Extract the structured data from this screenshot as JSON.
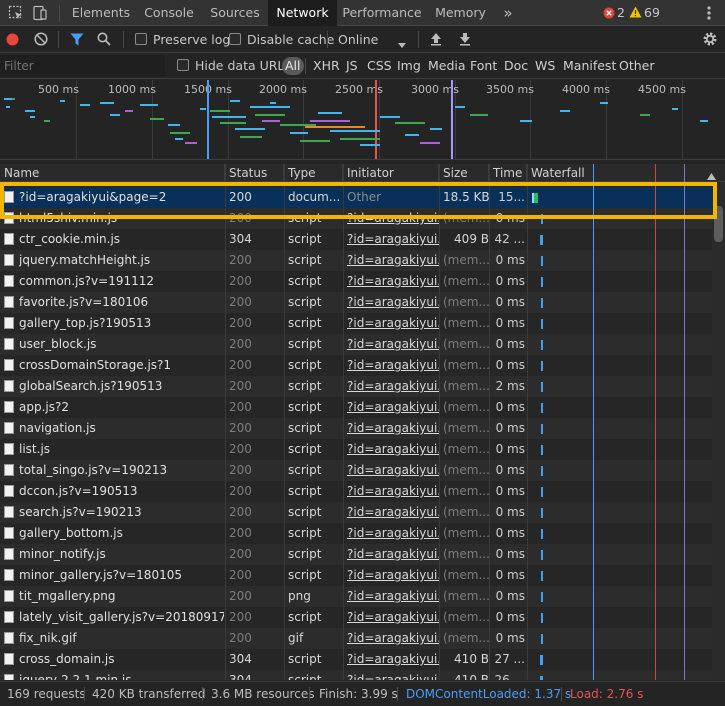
{
  "tabs": {
    "elements": "Elements",
    "console": "Console",
    "sources": "Sources",
    "network": "Network",
    "performance": "Performance",
    "memory": "Memory",
    "more": "»"
  },
  "badges": {
    "errors": "2",
    "warnings": "69"
  },
  "toolbar": {
    "preserve_log": "Preserve log",
    "disable_cache": "Disable cache",
    "throttling": "Online"
  },
  "filter": {
    "placeholder": "Filter",
    "hide_data_urls": "Hide data URLs",
    "types": [
      "All",
      "XHR",
      "JS",
      "CSS",
      "Img",
      "Media",
      "Font",
      "Doc",
      "WS",
      "Manifest",
      "Other"
    ]
  },
  "overview_ticks": [
    "500 ms",
    "1000 ms",
    "1500 ms",
    "2000 ms",
    "2500 ms",
    "3000 ms",
    "3500 ms",
    "4000 ms",
    "4500 ms"
  ],
  "columns": {
    "name": "Name",
    "status": "Status",
    "type": "Type",
    "initiator": "Initiator",
    "size": "Size",
    "time": "Time",
    "waterfall": "Waterfall"
  },
  "rows": [
    {
      "name": "?id=aragakiyui&page=2",
      "status": "200",
      "type": "docum...",
      "initiator": "Other",
      "size": "18.5 KB",
      "time": "15...",
      "selected": true
    },
    {
      "name": "html5shiv.min.js",
      "status": "200",
      "type": "script",
      "initiator": "?id=aragakiyui...",
      "size": "(mem...",
      "time": "0 ms"
    },
    {
      "name": "ctr_cookie.min.js",
      "status": "304",
      "type": "script",
      "initiator": "?id=aragakiyui...",
      "size": "409 B",
      "time": "42 ..."
    },
    {
      "name": "jquery.matchHeight.js",
      "status": "200",
      "type": "script",
      "initiator": "?id=aragakiyui...",
      "size": "(mem...",
      "time": "0 ms"
    },
    {
      "name": "common.js?v=191112",
      "status": "200",
      "type": "script",
      "initiator": "?id=aragakiyui...",
      "size": "(mem...",
      "time": "0 ms"
    },
    {
      "name": "favorite.js?v=180106",
      "status": "200",
      "type": "script",
      "initiator": "?id=aragakiyui...",
      "size": "(mem...",
      "time": "0 ms"
    },
    {
      "name": "gallery_top.js?190513",
      "status": "200",
      "type": "script",
      "initiator": "?id=aragakiyui...",
      "size": "(mem...",
      "time": "0 ms"
    },
    {
      "name": "user_block.js",
      "status": "200",
      "type": "script",
      "initiator": "?id=aragakiyui...",
      "size": "(mem...",
      "time": "0 ms"
    },
    {
      "name": "crossDomainStorage.js?1",
      "status": "200",
      "type": "script",
      "initiator": "?id=aragakiyui...",
      "size": "(mem...",
      "time": "0 ms"
    },
    {
      "name": "globalSearch.js?190513",
      "status": "200",
      "type": "script",
      "initiator": "?id=aragakiyui...",
      "size": "(mem...",
      "time": "2 ms"
    },
    {
      "name": "app.js?2",
      "status": "200",
      "type": "script",
      "initiator": "?id=aragakiyui...",
      "size": "(mem...",
      "time": "0 ms"
    },
    {
      "name": "navigation.js",
      "status": "200",
      "type": "script",
      "initiator": "?id=aragakiyui...",
      "size": "(mem...",
      "time": "0 ms"
    },
    {
      "name": "list.js",
      "status": "200",
      "type": "script",
      "initiator": "?id=aragakiyui...",
      "size": "(mem...",
      "time": "0 ms"
    },
    {
      "name": "total_singo.js?v=190213",
      "status": "200",
      "type": "script",
      "initiator": "?id=aragakiyui...",
      "size": "(mem...",
      "time": "0 ms"
    },
    {
      "name": "dccon.js?v=190513",
      "status": "200",
      "type": "script",
      "initiator": "?id=aragakiyui...",
      "size": "(mem...",
      "time": "0 ms"
    },
    {
      "name": "search.js?v=190213",
      "status": "200",
      "type": "script",
      "initiator": "?id=aragakiyui...",
      "size": "(mem...",
      "time": "0 ms"
    },
    {
      "name": "gallery_bottom.js",
      "status": "200",
      "type": "script",
      "initiator": "?id=aragakiyui...",
      "size": "(mem...",
      "time": "0 ms"
    },
    {
      "name": "minor_notify.js",
      "status": "200",
      "type": "script",
      "initiator": "?id=aragakiyui...",
      "size": "(mem...",
      "time": "0 ms"
    },
    {
      "name": "minor_gallery.js?v=180105",
      "status": "200",
      "type": "script",
      "initiator": "?id=aragakiyui...",
      "size": "(mem...",
      "time": "0 ms"
    },
    {
      "name": "tit_mgallery.png",
      "status": "200",
      "type": "png",
      "initiator": "?id=aragakiyui...",
      "size": "(mem...",
      "time": "0 ms"
    },
    {
      "name": "lately_visit_gallery.js?v=20180917",
      "status": "200",
      "type": "script",
      "initiator": "?id=aragakiyui...",
      "size": "(mem...",
      "time": "0 ms"
    },
    {
      "name": "fix_nik.gif",
      "status": "200",
      "type": "gif",
      "initiator": "?id=aragakiyui...",
      "size": "(mem...",
      "time": "0 ms"
    },
    {
      "name": "cross_domain.js",
      "status": "304",
      "type": "script",
      "initiator": "?id=aragakiyui...",
      "size": "410 B",
      "time": "27 ..."
    },
    {
      "name": "jquery-2.2.1.min.js",
      "status": "304",
      "type": "script",
      "initiator": "?id=aragakiyui...",
      "size": "410 B",
      "time": "26 ..."
    }
  ],
  "status_bar": {
    "requests": "169 requests",
    "transferred": "420 KB transferred",
    "resources": "3.6 MB resources",
    "finish": "Finish: 3.99 s",
    "dom_content_loaded": "DOMContentLoaded: 1.37 s",
    "load": "Load: 2.76 s"
  },
  "colors": {
    "accent_blue": "#4a9cf6",
    "dcl_blue": "#4a9cf6",
    "load_red": "#e0574f",
    "highlight": "#f2b600",
    "selected_row": "#083058"
  }
}
